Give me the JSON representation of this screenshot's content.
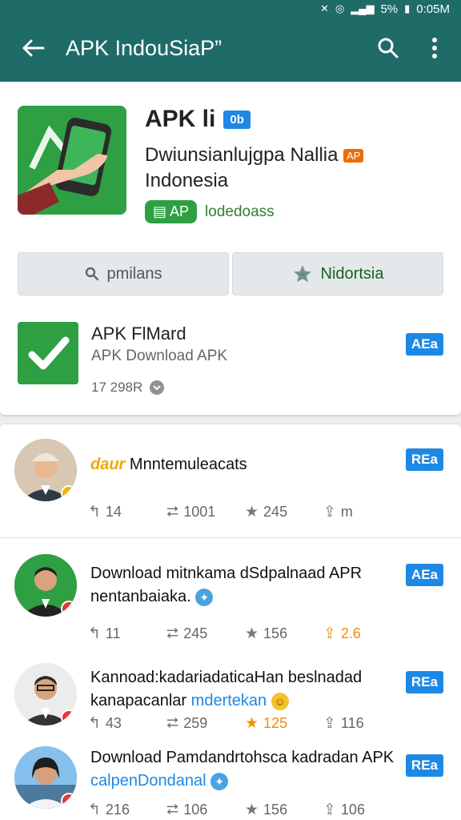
{
  "status_bar": {
    "battery": "5%",
    "time": "0:05M"
  },
  "app_bar": {
    "title": "APK IndouSiaP”"
  },
  "app": {
    "title": "APK li",
    "tag": "0b",
    "subtitle_line1": "Dwiunsianlujgpa Nallia",
    "subtitle_tag": "AP",
    "subtitle_line2": "Indonesia",
    "pill_label": "AP",
    "pill_text": "lodedoass",
    "button_left": "pmilans",
    "button_right": "Nidortsia"
  },
  "download_row": {
    "title": "APK FlMard",
    "subtitle": "APK Download APK",
    "meta": "17 298R",
    "read_label": "AEa"
  },
  "posts": [
    {
      "text": "Mnntemuleacats",
      "overlay": "daur",
      "read_label": "REa",
      "stats": [
        "14",
        "1001",
        "245",
        "m"
      ],
      "highlight": -1
    },
    {
      "text": "Download mitnkama dSdpalnaad APR",
      "text2": "nentanbaiaka.",
      "read_label": "AEa",
      "stats": [
        "11",
        "245",
        "156",
        "2.6"
      ],
      "highlight": 3
    },
    {
      "text": "Kannoad:kadariadaticaHan beslnadad",
      "text2": "kanapacanlar",
      "text2_accent": "mdertekan",
      "read_label": "REa",
      "stats": [
        "43",
        "259",
        "125",
        "116"
      ],
      "highlight": 2
    },
    {
      "text": "Download Pamdandrtohsca kadradan APK",
      "text2": "calpenDondanal",
      "read_label": "REa",
      "stats": [
        "216",
        "106",
        "156",
        "106"
      ],
      "highlight": -1
    }
  ],
  "colors": {
    "appbar": "#1f6b68",
    "accent": "#1e88e5",
    "green": "#2ea043",
    "orange": "#ef8c00"
  }
}
